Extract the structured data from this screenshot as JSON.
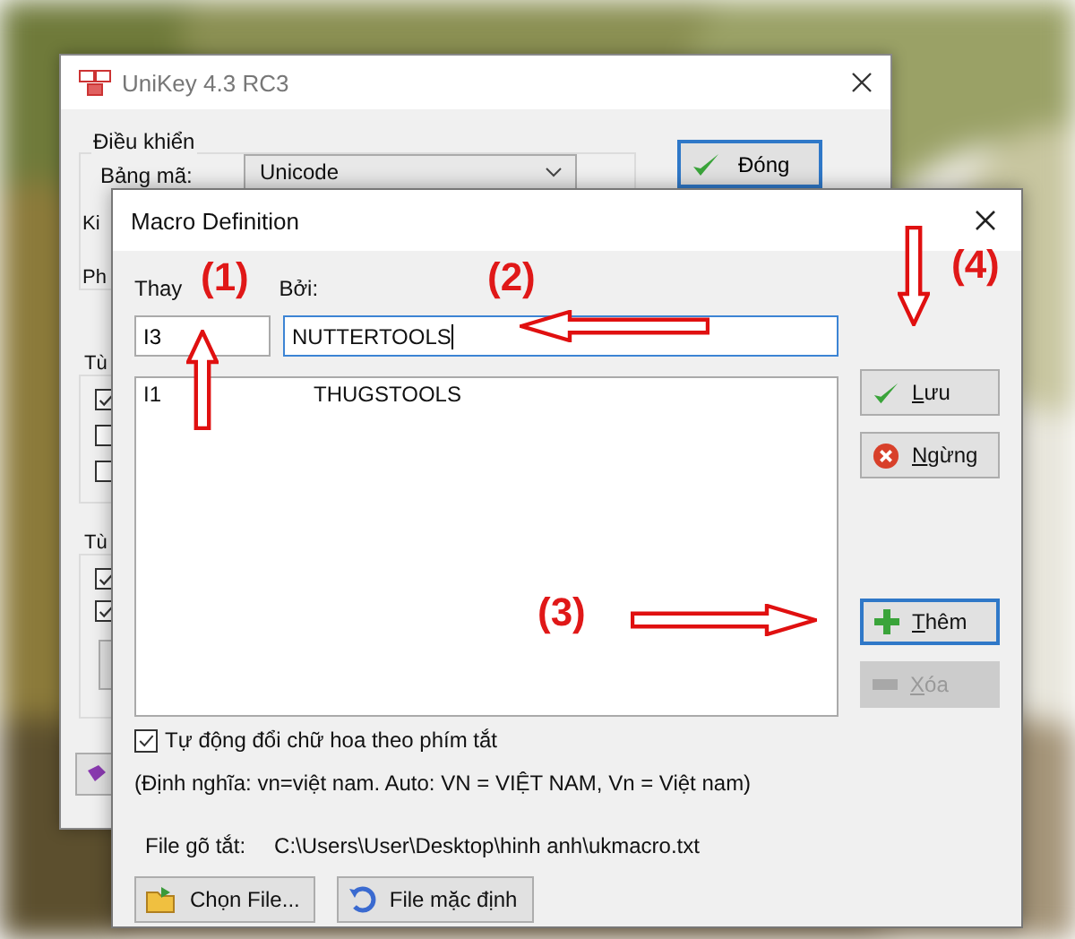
{
  "back_window": {
    "title": "UniKey 4.3 RC3",
    "group_label": "Điều khiển",
    "charset_label": "Bảng mã:",
    "charset_value": "Unicode",
    "close_button": "Đóng",
    "cut_labels": [
      "Ki",
      "Ph"
    ],
    "groups": [
      {
        "label": "Tù",
        "checkboxes": [
          {
            "checked": true
          },
          {
            "checked": false
          },
          {
            "checked": false
          }
        ]
      },
      {
        "label": "Tù",
        "checkboxes": [
          {
            "checked": true
          },
          {
            "checked": true
          }
        ]
      }
    ]
  },
  "dialog": {
    "title": "Macro Definition",
    "replace_label": "Thay",
    "replace_value": "I3",
    "with_label": "Bởi:",
    "with_value": "NUTTERTOOLS",
    "rows": [
      {
        "key": "I1",
        "text": "THUGSTOOLS",
        "selected": false
      }
    ],
    "buttons": [
      {
        "label": "Lưu",
        "kind": "save",
        "disabled": false,
        "default": false
      },
      {
        "label": "Ngừng",
        "kind": "cancel",
        "disabled": false,
        "default": false
      },
      {
        "label": "Thêm",
        "kind": "add",
        "disabled": false,
        "default": true
      },
      {
        "label": "Xóa",
        "kind": "delete",
        "disabled": true,
        "default": false
      }
    ],
    "auto_case": {
      "label": "Tự động đổi chữ hoa theo phím tắt",
      "checked": true
    },
    "note": "(Định nghĩa: vn=việt nam. Auto: VN = VIỆT NAM, Vn = Việt nam)",
    "file_label": "File gõ tắt:",
    "file_path": "C:\\Users\\User\\Desktop\\hinh anh\\ukmacro.txt",
    "file_buttons": [
      {
        "label": "Chọn File...",
        "kind": "open"
      },
      {
        "label": "File mặc định",
        "kind": "default"
      }
    ]
  },
  "annotations": [
    {
      "label": "(1)"
    },
    {
      "label": "(2)"
    },
    {
      "label": "(3)"
    },
    {
      "label": "(4)"
    }
  ]
}
